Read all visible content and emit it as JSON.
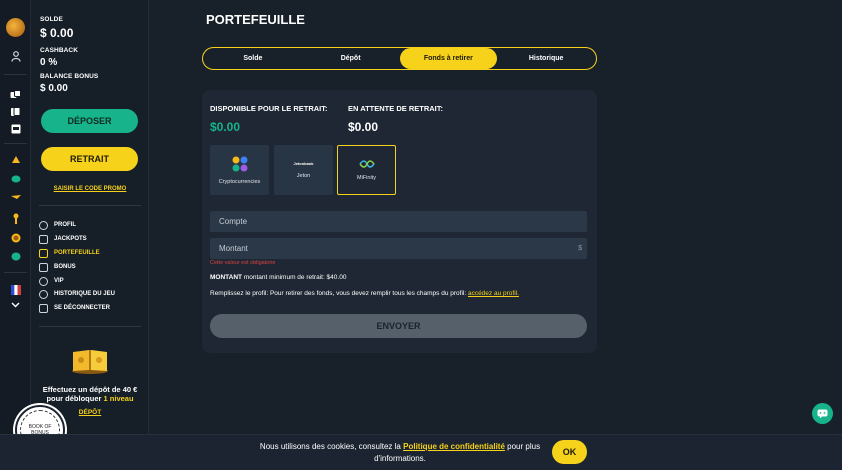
{
  "rail": {
    "icons": [
      "logo-icon",
      "user-icon",
      "dice-icon",
      "cards-icon",
      "slot-icon",
      "bell-icon",
      "chip-icon",
      "trophy-icon",
      "medal-icon",
      "coin-icon",
      "flag-fr-icon",
      "chevron-down-icon"
    ]
  },
  "panel": {
    "solde_label": "SOLDE",
    "solde_value": "$ 0.00",
    "cashback_label": "CASHBACK",
    "cashback_value": "0 %",
    "bonus_label": "BALANCE BONUS",
    "bonus_value": "$ 0.00",
    "deposit_button": "DÉPOSER",
    "withdraw_button": "RETRAIT",
    "promo_link": "SAISIR LE CODE PROMO",
    "menu": [
      {
        "label": "PROFIL",
        "icon": "profile-icon"
      },
      {
        "label": "JACKPOTS",
        "icon": "star-icon"
      },
      {
        "label": "PORTEFEUILLE",
        "icon": "wallet-icon",
        "active": true
      },
      {
        "label": "BONUS",
        "icon": "gift-icon"
      },
      {
        "label": "VIP",
        "icon": "crown-icon"
      },
      {
        "label": "HISTORIQUE DU JEU",
        "icon": "clock-icon"
      },
      {
        "label": "SE DÉCONNECTER",
        "icon": "logout-icon"
      }
    ],
    "level_text_1": "Effectuez un dépôt de 40 €",
    "level_text_2": "pour débloquer",
    "level_text_highlight": "1 niveau",
    "deposit_link": "DÉPÔT"
  },
  "badge": {
    "text": "BOOK OF BONUS"
  },
  "main": {
    "title": "PORTEFEUILLE",
    "tabs": [
      {
        "label": "Solde"
      },
      {
        "label": "Dépôt"
      },
      {
        "label": "Fonds à retirer",
        "active": true
      },
      {
        "label": "Historique"
      }
    ],
    "available_label": "DISPONIBLE POUR LE RETRAIT:",
    "available_value": "$0.00",
    "pending_label": "EN ATTENTE DE RETRAIT:",
    "pending_value": "$0.00",
    "methods": [
      {
        "label": "Cryptocurrencies",
        "icon": "crypto-icon"
      },
      {
        "label": "Jeton",
        "icon": "jeton-logo-icon",
        "logo_text": "Jetonbank"
      },
      {
        "label": "MiFinity",
        "icon": "mifinity-logo-icon",
        "selected": true
      }
    ],
    "account_placeholder": "Compte",
    "amount_placeholder": "Montant",
    "currency_symbol": "$",
    "error_text": "Cette valeur est obligatoire",
    "min_label": "MONTANT",
    "min_text": "montant minimum de retrait: $40.00",
    "fill_text": "Remplissez le profil: Pour retirer des fonds, vous devez remplir tous les champs du profil:",
    "fill_link": "accédez au profil.",
    "send_button": "ENVOYER"
  },
  "cookie": {
    "text_before": "Nous utilisons des cookies, consultez la",
    "link": "Politique de confidentialité",
    "text_after": "pour plus d'informations.",
    "ok_button": "OK"
  },
  "colors": {
    "accent_yellow": "#f6d21a",
    "accent_green": "#17b38a",
    "background": "#18202a"
  }
}
